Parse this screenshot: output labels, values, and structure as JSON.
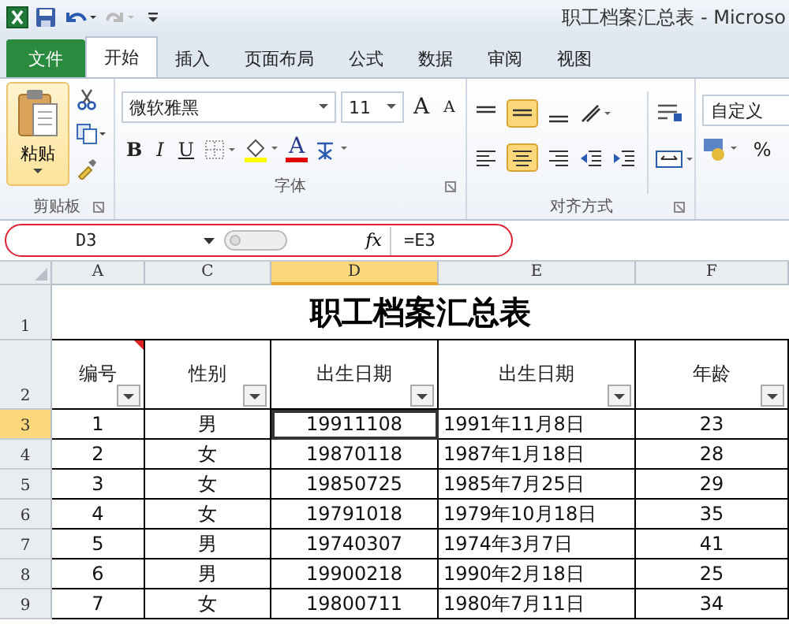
{
  "title_bar": {
    "title": "职工档案汇总表  -  Microso"
  },
  "tabs": [
    {
      "label": "文件",
      "kind": "file",
      "selected": false
    },
    {
      "label": "开始",
      "kind": "tab",
      "selected": true
    },
    {
      "label": "插入",
      "kind": "tab",
      "selected": false
    },
    {
      "label": "页面布局",
      "kind": "tab",
      "selected": false
    },
    {
      "label": "公式",
      "kind": "tab",
      "selected": false
    },
    {
      "label": "数据",
      "kind": "tab",
      "selected": false
    },
    {
      "label": "审阅",
      "kind": "tab",
      "selected": false
    },
    {
      "label": "视图",
      "kind": "tab",
      "selected": false
    }
  ],
  "ribbon": {
    "paste_label": "粘贴",
    "font_name": "微软雅黑",
    "font_size": "11",
    "grow_letter": "A",
    "shrink_letter": "A",
    "bold": "B",
    "italic": "I",
    "underline": "U",
    "font_color_letter": "A",
    "number_format": "自定义",
    "percent": "%",
    "groups": [
      "剪贴板",
      "字体",
      "对齐方式"
    ]
  },
  "formula_bar": {
    "name_box": "D3",
    "fx": "fx",
    "formula": "=E3"
  },
  "columns": [
    {
      "label": "A",
      "selected": false
    },
    {
      "label": "C",
      "selected": false
    },
    {
      "label": "D",
      "selected": true
    },
    {
      "label": "E",
      "selected": false
    },
    {
      "label": "F",
      "selected": false
    }
  ],
  "sheet_title": {
    "row": "1",
    "text": "职工档案汇总表"
  },
  "header_row": {
    "row": "2",
    "cells": [
      "编号",
      "性别",
      "出生日期",
      "出生日期",
      "年龄"
    ]
  },
  "rows": [
    {
      "row": "3",
      "selected": true,
      "cells": [
        "1",
        "男",
        "19911108",
        "1991年11月8日",
        "23"
      ]
    },
    {
      "row": "4",
      "selected": false,
      "cells": [
        "2",
        "女",
        "19870118",
        "1987年1月18日",
        "28"
      ]
    },
    {
      "row": "5",
      "selected": false,
      "cells": [
        "3",
        "女",
        "19850725",
        "1985年7月25日",
        "29"
      ]
    },
    {
      "row": "6",
      "selected": false,
      "cells": [
        "4",
        "女",
        "19791018",
        "1979年10月18日",
        "35"
      ]
    },
    {
      "row": "7",
      "selected": false,
      "cells": [
        "5",
        "男",
        "19740307",
        "1974年3月7日",
        "41"
      ]
    },
    {
      "row": "8",
      "selected": false,
      "cells": [
        "6",
        "男",
        "19900218",
        "1990年2月18日",
        "25"
      ]
    },
    {
      "row": "9",
      "selected": false,
      "cells": [
        "7",
        "女",
        "19800711",
        "1980年7月11日",
        "34"
      ]
    }
  ]
}
